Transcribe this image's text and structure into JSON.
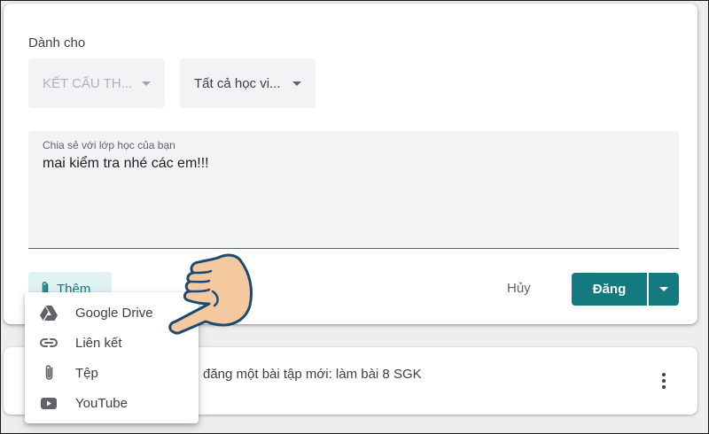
{
  "assign": {
    "for_label": "Dành cho",
    "class_select": "KẾT CẤU TH...",
    "students_select": "Tất cả học vi..."
  },
  "composer": {
    "placeholder": "Chia sẻ với lớp học của bạn",
    "value": "mai kiểm tra nhé các em!!!"
  },
  "actions": {
    "add_label": "Thêm",
    "cancel_label": "Hủy",
    "post_label": "Đăng"
  },
  "add_menu": {
    "items": [
      {
        "label": "Google Drive",
        "icon": "google-drive-icon"
      },
      {
        "label": "Liên kết",
        "icon": "link-icon"
      },
      {
        "label": "Tệp",
        "icon": "paperclip-icon"
      },
      {
        "label": "YouTube",
        "icon": "youtube-icon"
      }
    ]
  },
  "stream": {
    "announcement_fragment": "đăng một bài tập mới: làm bài 8 SGK"
  },
  "colors": {
    "accent": "#137a7f",
    "accent_light": "#e0f2f1",
    "hand": "#f5c9a0"
  }
}
